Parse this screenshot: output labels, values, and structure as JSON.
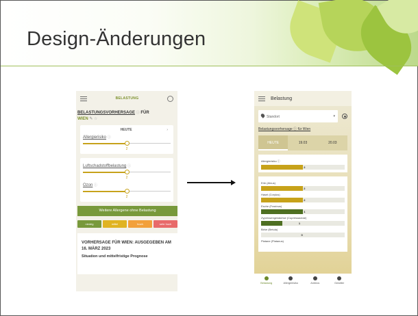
{
  "slide": {
    "title": "Design-Änderungen"
  },
  "left": {
    "header": "BELASTUNG",
    "forecast_title": "BELASTUNGSVORHERSAGE",
    "forecast_for": "FÜR",
    "city": "WIEN",
    "day": "HEUTE",
    "allergy_label": "Allergierisiko",
    "allergy_value": "2",
    "allergy_level": 0.5,
    "pollution_label": "Luftschadstoffbelastung",
    "pollution_value": "2",
    "pollution_level": 0.5,
    "ozone_label": "Ozon",
    "ozone_value": "2",
    "ozone_level": 0.5,
    "button_label": "Weitere Allergene ohne Belastung",
    "legend": [
      {
        "label": "niedrig",
        "color": "#78993b"
      },
      {
        "label": "mittel",
        "color": "#e0b322"
      },
      {
        "label": "hoch",
        "color": "#f2a03b"
      },
      {
        "label": "sehr hoch",
        "color": "#e86a6a"
      }
    ],
    "bulletin_title": "VORHERSAGE FÜR WIEN: AUSGEGEBEN AM 16. MÄRZ 2023",
    "bulletin_subtitle": "Situation und mittelfristige Prognose"
  },
  "right": {
    "header": "Belastung",
    "location_placeholder": "Standort",
    "forecast_link": "Belastungsvorhersage ⓘ für Wien",
    "tabs": [
      "HEUTE",
      "19.03",
      "20.03"
    ],
    "allergy": {
      "label": "Allergierisiko ⓘ",
      "value": "2",
      "level": 0.5,
      "color": "#c7a21a"
    },
    "items": [
      {
        "label": "Erle (Alnus)",
        "value": "2",
        "level": 0.5,
        "color": "#c7a21a"
      },
      {
        "label": "Hasel (Corylus)",
        "value": "2",
        "level": 0.5,
        "color": "#c7a21a"
      },
      {
        "label": "Esche (Fraxinus)",
        "value": "1",
        "level": 0.5,
        "color": "#4e6f22"
      },
      {
        "label": "Zypressengewächse (Cupressaceae)",
        "value": "1",
        "level": 0.25,
        "color": "#4e6f22"
      },
      {
        "label": "Birke (Betula)",
        "value": "0",
        "level": 0,
        "color": "#cccccc"
      },
      {
        "label": "Platane (Platanus)",
        "value": "",
        "level": 0,
        "color": "#cccccc"
      }
    ],
    "nav": [
      "Belastung",
      "Allergierisiko",
      "Ambros",
      "Gewitter"
    ]
  }
}
